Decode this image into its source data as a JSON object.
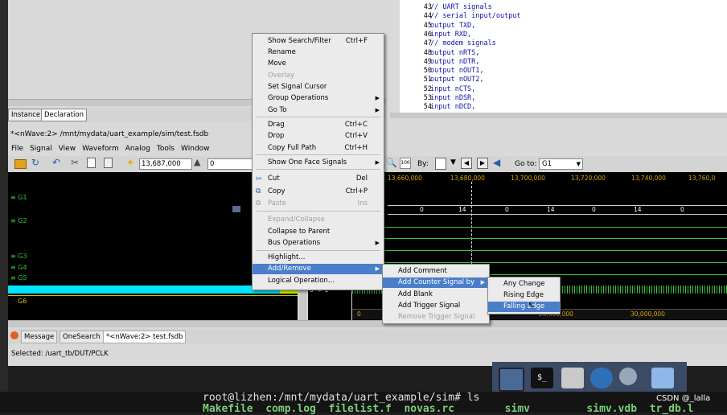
{
  "code": {
    "lines": [
      {
        "n": "43",
        "t": "// UART signals"
      },
      {
        "n": "44",
        "t": "// serial input/output"
      },
      {
        "n": "45",
        "t": "output TXD,"
      },
      {
        "n": "46",
        "t": "input RXD,"
      },
      {
        "n": "47",
        "t": "// modem signals"
      },
      {
        "n": "48",
        "t": "output nRTS,"
      },
      {
        "n": "49",
        "t": "output nDTR,"
      },
      {
        "n": "50",
        "t": "output nOUT1,"
      },
      {
        "n": "51",
        "t": "output nOUT2,"
      },
      {
        "n": "52",
        "t": "input nCTS,"
      },
      {
        "n": "53",
        "t": "input nDSR,"
      },
      {
        "n": "54",
        "t": "input nDCD,"
      }
    ]
  },
  "tabs_top": {
    "instance": "Instance",
    "declaration": "Declaration"
  },
  "nwave": {
    "title": "*<nWave:2> /mnt/mydata/uart_example/sim/test.fsdb",
    "menu": [
      "File",
      "Signal",
      "View",
      "Waveform",
      "Analog",
      "Tools",
      "Window"
    ],
    "cursor_time": "13,687,000",
    "delta": "0",
    "by_label": "By:",
    "goto_label": "Go to:",
    "goto_value": "G1",
    "time_ticks": [
      "13,660,000",
      "13,680,000",
      "13,700,000",
      "13,720,000",
      "13,740,000",
      "13,760,0"
    ],
    "groups": [
      "G1",
      "G2",
      "G3",
      "G4",
      "G5",
      "G6"
    ],
    "pclk_label": "PCLK",
    "bus_values": [
      "0",
      "14",
      "0",
      "14",
      "0",
      "14",
      "0"
    ],
    "zoom_value": "0 -> 1",
    "bottom_ticks": [
      "0",
      "20,000,000",
      "30,000,000"
    ],
    "status": "Selected: /uart_tb/DUT/PCLK"
  },
  "bottom_tabs": [
    "Message",
    "OneSearch",
    "*<nWave:2> test.fsdb"
  ],
  "context_menu": {
    "items": [
      {
        "label": "Show Search/Filter",
        "shortcut": "Ctrl+F"
      },
      {
        "label": "Rename"
      },
      {
        "label": "Move"
      },
      {
        "label": "Overlay",
        "disabled": true
      },
      {
        "label": "Set Signal Cursor"
      },
      {
        "label": "Group Operations",
        "submenu": true
      },
      {
        "label": "Go To",
        "submenu": true
      },
      {
        "label": "Drag",
        "shortcut": "Ctrl+C"
      },
      {
        "label": "Drop",
        "shortcut": "Ctrl+V"
      },
      {
        "label": "Copy Full Path",
        "shortcut": "Ctrl+H"
      },
      {
        "label": "Show One Face Signals",
        "submenu": true
      },
      {
        "label": "Cut",
        "shortcut": "Del"
      },
      {
        "label": "Copy",
        "shortcut": "Ctrl+P"
      },
      {
        "label": "Paste",
        "shortcut": "Ins",
        "disabled": true
      },
      {
        "label": "Expand/Collapse",
        "disabled": true
      },
      {
        "label": "Collapse to Parent"
      },
      {
        "label": "Bus Operations",
        "submenu": true
      },
      {
        "label": "Highlight..."
      },
      {
        "label": "Add/Remove",
        "submenu": true,
        "selected": true
      },
      {
        "label": "Logical Operation..."
      }
    ]
  },
  "submenu_add": {
    "items": [
      {
        "label": "Add Comment"
      },
      {
        "label": "Add Counter Signal by",
        "submenu": true,
        "selected": true
      },
      {
        "label": "Add Blank"
      },
      {
        "label": "Add Trigger Signal"
      },
      {
        "label": "Remove Trigger Signal",
        "disabled": true
      }
    ]
  },
  "submenu_counter": {
    "items": [
      {
        "label": "Any Change"
      },
      {
        "label": "Rising Edge"
      },
      {
        "label": "Falling Edge",
        "selected": true
      }
    ]
  },
  "terminal": {
    "prompt": "root@lizhen:/mnt/mydata/uart_example/sim# ls",
    "files": "Makefile  comp.log  filelist.f  novas.rc        simv         simv.vdb  tr_db.l"
  },
  "watermark": "CSDN @_lalla",
  "colors": {
    "menu_highlight": "#4a7ecb",
    "signal_selected": "#00e5ff",
    "wave_green": "#39c239",
    "tick_gold": "#d4a300"
  }
}
